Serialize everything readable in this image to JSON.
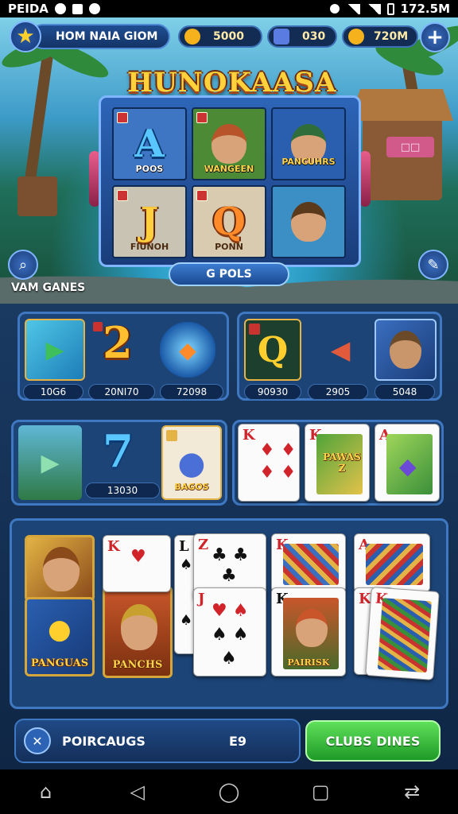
{
  "status_bar": {
    "left_text": "PEIDA",
    "time": "172.5M"
  },
  "top_bar": {
    "title": "HOM NAIA GIOM",
    "currencies": [
      {
        "value": "5000",
        "color": "#f5b21c"
      },
      {
        "value": "030",
        "color": "#5a7be0"
      },
      {
        "value": "720M",
        "color": "#f5b21c"
      }
    ]
  },
  "slot": {
    "logo": "HUNOKAASA",
    "reels": [
      {
        "glyph": "A",
        "caption": "POOS",
        "bg": "#3f76c4"
      },
      {
        "glyph": "",
        "caption": "WANGEEN",
        "bg": "#4c8a36"
      },
      {
        "glyph": "",
        "caption": "PANCUHRS",
        "bg": "#2a5fb0"
      },
      {
        "glyph": "J",
        "caption": "FIUNOH",
        "bg": "#c9c3b3"
      },
      {
        "glyph": "Q",
        "caption": "PONN",
        "bg": "#d9cbb0"
      },
      {
        "glyph": "",
        "caption": "",
        "bg": "#3b8fc4"
      }
    ],
    "pill_label": "G POLS"
  },
  "section_label": "VAM GANES",
  "panel1": {
    "number": "2",
    "values": [
      "10G6",
      "20NI70",
      "72098"
    ]
  },
  "panel2": {
    "glyph": "Q",
    "values": [
      "90930",
      "2905",
      "5048"
    ]
  },
  "panel3": {
    "number": "7",
    "value": "13030",
    "tile_caption": "BAGOS"
  },
  "panel4": {
    "card_art_caption": "PAWAS Z"
  },
  "hand": {
    "portrait_captions": [
      "PANGUAS",
      "PANCHS",
      "PANGUAS"
    ],
    "card_ranks": [
      "K",
      "L",
      "Z",
      "K",
      "A",
      "K",
      "J",
      "K",
      "K"
    ],
    "portrait_card_caption": "PAIRISK"
  },
  "action_bar": {
    "left_label": "POIRCAUGS",
    "left_value": "E9",
    "right_button": "CLUBS DINES"
  }
}
